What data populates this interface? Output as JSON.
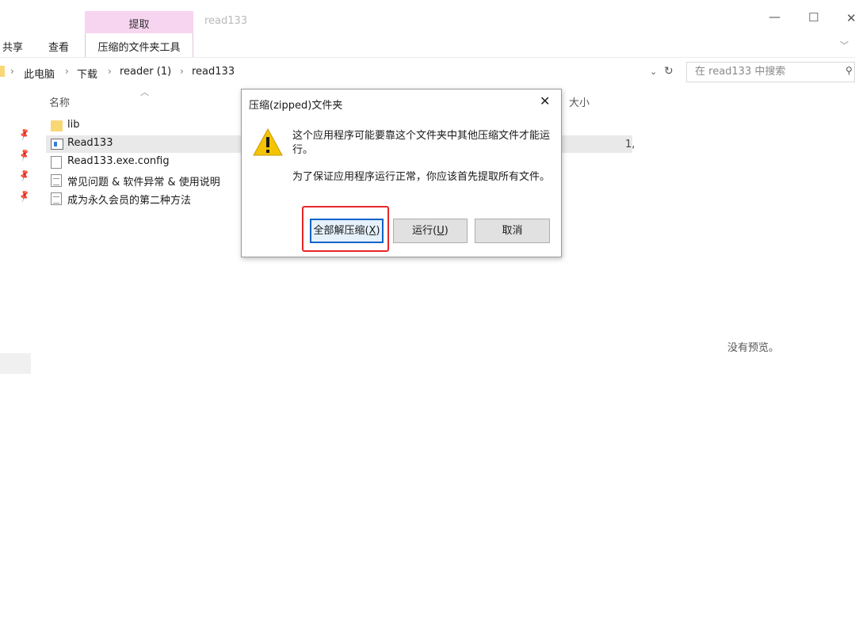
{
  "ribbon": {
    "context_group_label": "提取",
    "tool_tab_label": "压缩的文件夹工具",
    "share_tab": "共享",
    "view_tab": "查看",
    "window_title": "read133",
    "colors": {
      "context_tab": "#f7d4ef"
    }
  },
  "window_controls": {
    "minimize": "—",
    "maximize": "☐",
    "close": "✕"
  },
  "address": {
    "crumbs": [
      "此电脑",
      "下载",
      "reader (1)",
      "read133"
    ],
    "separator": "›"
  },
  "search": {
    "placeholder": "在 read133 中搜索"
  },
  "file_list": {
    "columns": {
      "name": "名称",
      "size": "大小"
    },
    "items": [
      {
        "name": "lib",
        "icon": "folder-icon"
      },
      {
        "name": "Read133",
        "icon": "app-icon"
      },
      {
        "name": "Read133.exe.config",
        "icon": "file-icon"
      },
      {
        "name": "常见问题 & 软件异常 & 使用说明",
        "icon": "text-file-icon"
      },
      {
        "name": "成为永久会员的第二种方法",
        "icon": "text-file-icon"
      }
    ],
    "partial_size": "1,"
  },
  "preview": {
    "empty_text": "没有预览。"
  },
  "dialog": {
    "title": "压缩(zipped)文件夹",
    "message1": "这个应用程序可能要靠这个文件夹中其他压缩文件才能运行。",
    "message2": "为了保证应用程序运行正常，你应该首先提取所有文件。",
    "buttons": {
      "extract_all": {
        "label": "全部解压缩",
        "key": "X"
      },
      "run": {
        "label": "运行",
        "key": "U"
      },
      "cancel": {
        "label": "取消"
      }
    },
    "colors": {
      "highlight": "#e8262a",
      "default_button_border": "#0a64c8"
    }
  }
}
